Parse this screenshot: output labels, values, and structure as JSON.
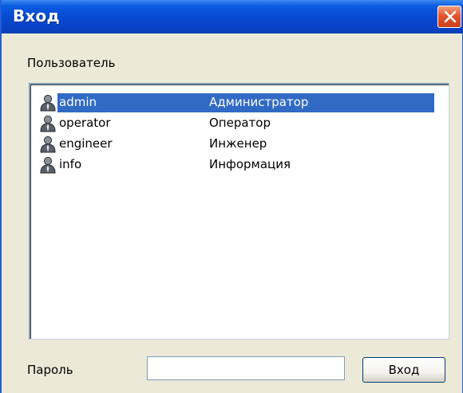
{
  "window": {
    "title": "Вход"
  },
  "user_section": {
    "label": "Пользователь",
    "users": [
      {
        "name": "admin",
        "role": "Администратор",
        "selected": true
      },
      {
        "name": "operator",
        "role": "Оператор",
        "selected": false
      },
      {
        "name": "engineer",
        "role": "Инженер",
        "selected": false
      },
      {
        "name": "info",
        "role": "Информация",
        "selected": false
      }
    ]
  },
  "password": {
    "label": "Пароль",
    "value": ""
  },
  "login_button": {
    "label": "Вход"
  },
  "icons": {
    "close": "close-icon",
    "user": "user-icon"
  },
  "colors": {
    "titlebar": "#0a5be0",
    "selection": "#316ac5",
    "close_button": "#e4552b",
    "dialog_bg": "#ece9d8"
  }
}
